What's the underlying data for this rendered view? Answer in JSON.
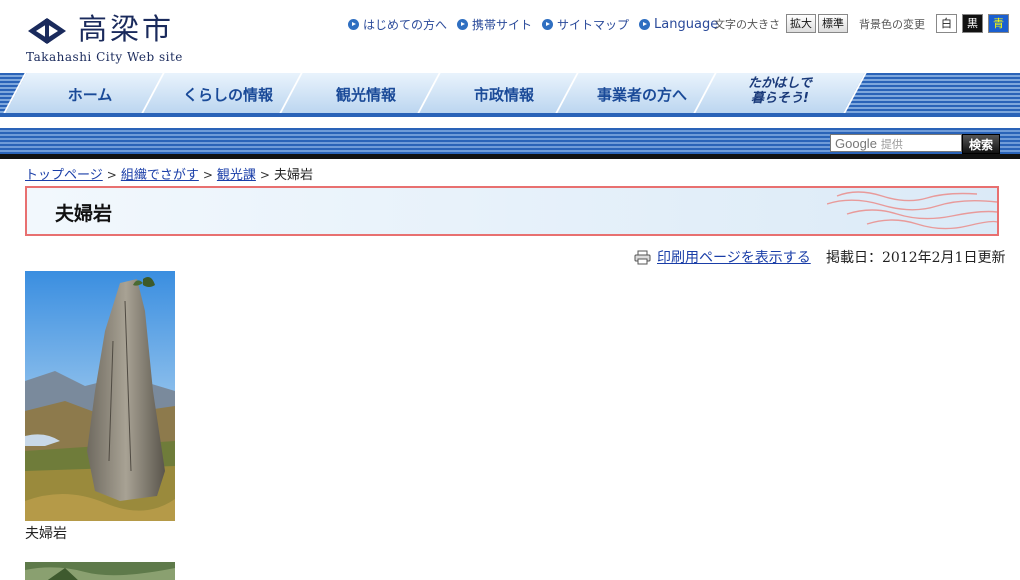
{
  "site": {
    "logo_title": "高梁市",
    "logo_subtitle": "Takahashi City Web site"
  },
  "header": {
    "links": [
      "はじめての方へ",
      "携帯サイト",
      "サイトマップ",
      "Language"
    ],
    "font_size_label": "文字の大きさ",
    "font_size_buttons": [
      "拡大",
      "標準"
    ],
    "bg_color_label": "背景色の変更",
    "bg_color_buttons": [
      "白",
      "黒",
      "青"
    ]
  },
  "nav": {
    "tabs": [
      "ホーム",
      "くらしの情報",
      "観光情報",
      "市政情報",
      "事業者の方へ"
    ],
    "special_tab": "たかはしで\n暮らそう!"
  },
  "search": {
    "placeholder_brand": "Google",
    "placeholder_suffix": "提供",
    "button_label": "検索"
  },
  "breadcrumb": {
    "items": [
      "トップページ",
      "組織でさがす",
      "観光課"
    ],
    "separator": ">",
    "current": "夫婦岩"
  },
  "page": {
    "title": "夫婦岩",
    "print_link": "印刷用ページを表示する",
    "date": "掲載日：2012年2月1日更新",
    "photo_caption": "夫婦岩"
  },
  "colors": {
    "nav_blue": "#2a63b8",
    "link": "#1a3ea8",
    "title_border": "#e87070"
  }
}
